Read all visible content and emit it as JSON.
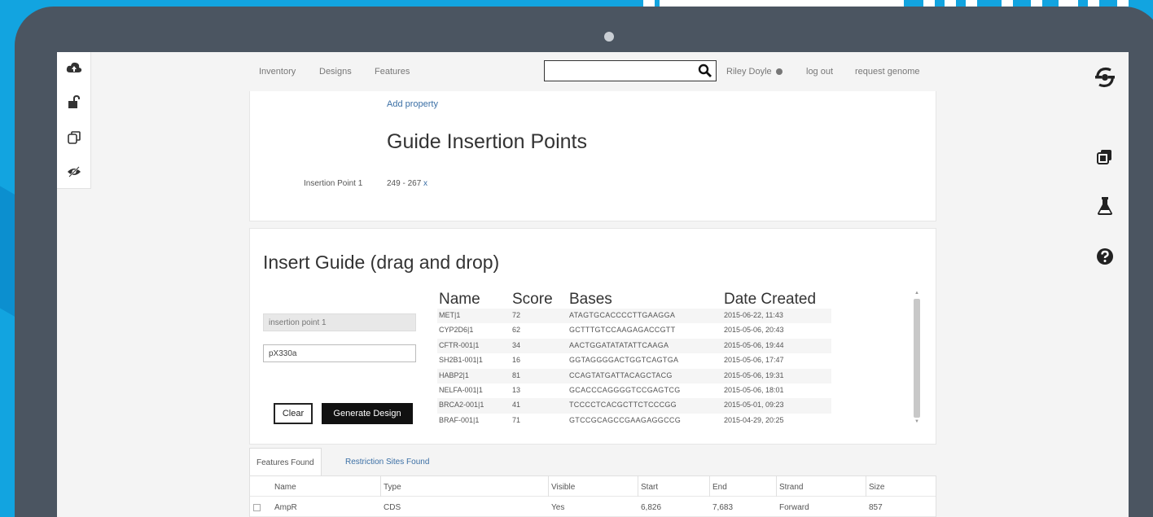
{
  "nav": {
    "links": [
      "Inventory",
      "Designs",
      "Features"
    ],
    "search_placeholder": "",
    "user": "Riley Doyle",
    "logout": "log out",
    "request_genome": "request genome"
  },
  "properties_panel": {
    "add_property": "Add property",
    "title": "Guide Insertion Points",
    "insertion_label": "Insertion Point 1",
    "insertion_value": "249 - 267",
    "remove_symbol": "x"
  },
  "insert_panel": {
    "title": "Insert Guide (drag and drop)",
    "insertion_point_placeholder": "insertion point 1",
    "design_name_value": "pX330a",
    "clear_label": "Clear",
    "generate_label": "Generate Design",
    "columns": [
      "Name",
      "Score",
      "Bases",
      "Date Created"
    ],
    "rows": [
      {
        "name": "MET|1",
        "score": "72",
        "bases": "ATAGTGCACCCCTTGAAGGA",
        "date": "2015-06-22, 11:43"
      },
      {
        "name": "CYP2D6|1",
        "score": "62",
        "bases": "GCTTTGTCCAAGAGACCGTT",
        "date": "2015-05-06, 20:43"
      },
      {
        "name": "CFTR-001|1",
        "score": "34",
        "bases": "AACTGGATATATATTCAAGA",
        "date": "2015-05-06, 19:44"
      },
      {
        "name": "SH2B1-001|1",
        "score": "16",
        "bases": "GGTAGGGGACTGGTCAGTGA",
        "date": "2015-05-06, 17:47"
      },
      {
        "name": "HABP2|1",
        "score": "81",
        "bases": "CCAGTATGATTACAGCTACG",
        "date": "2015-05-06, 19:31"
      },
      {
        "name": "NELFA-001|1",
        "score": "13",
        "bases": "GCACCCAGGGGTCCGAGTCG",
        "date": "2015-05-06, 18:01"
      },
      {
        "name": "BRCA2-001|1",
        "score": "41",
        "bases": "TCCCCTCACGCTTCTCCCGG",
        "date": "2015-05-01, 09:23"
      },
      {
        "name": "BRAF-001|1",
        "score": "71",
        "bases": "GTCCGCAGCCGAAGAGGCCG",
        "date": "2015-04-29, 20:25"
      }
    ]
  },
  "features": {
    "tabs": [
      "Features Found",
      "Restriction Sites Found"
    ],
    "columns": [
      "Name",
      "Type",
      "Visible",
      "Start",
      "End",
      "Strand",
      "Size"
    ],
    "rows": [
      {
        "name": "AmpR",
        "type": "CDS",
        "visible": "Yes",
        "start": "6,826",
        "end": "7,683",
        "strand": "Forward",
        "size": "857"
      }
    ]
  },
  "colors": {
    "background": "#12a4e0",
    "bezel": "#4b5561",
    "link": "#3b6fa5",
    "primary_button": "#111111"
  }
}
